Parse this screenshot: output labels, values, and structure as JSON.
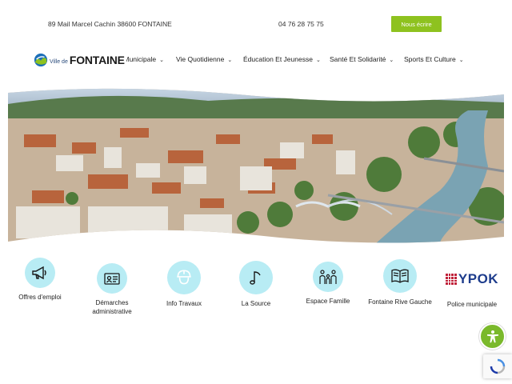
{
  "header": {
    "address": "89 Mail Marcel Cachin 38600 FONTAINE",
    "phone": "04 76 28 75 75",
    "contact_button": "Nous écrire"
  },
  "logo": {
    "prefix": "Ville de",
    "name": "FONTAINE"
  },
  "nav": {
    "items": [
      {
        "label": "Vie Municipale"
      },
      {
        "label": "Vie Quotidienne"
      },
      {
        "label": "Éducation Et Jeunesse"
      },
      {
        "label": "Santé Et Solidarité"
      },
      {
        "label": "Sports Et Culture"
      }
    ]
  },
  "hero": {
    "icon": "aerial-city-photo"
  },
  "services": {
    "items": [
      {
        "label": "Offres d'emploi",
        "icon": "megaphone-icon"
      },
      {
        "label": "Démarches administrative",
        "icon": "id-card-icon"
      },
      {
        "label": "Info Travaux",
        "icon": "worker-helmet-icon"
      },
      {
        "label": "La Source",
        "icon": "music-note-icon"
      },
      {
        "label": "Espace Famille",
        "icon": "family-icon"
      },
      {
        "label": "Fontaine Rive Gauche",
        "icon": "book-icon"
      },
      {
        "label": "Police municipale",
        "logo_text": "YPOK"
      }
    ]
  },
  "colors": {
    "accent_green": "#8ec21f",
    "icon_circle": "#b8ecf4",
    "a11y_button": "#7ab92b"
  }
}
